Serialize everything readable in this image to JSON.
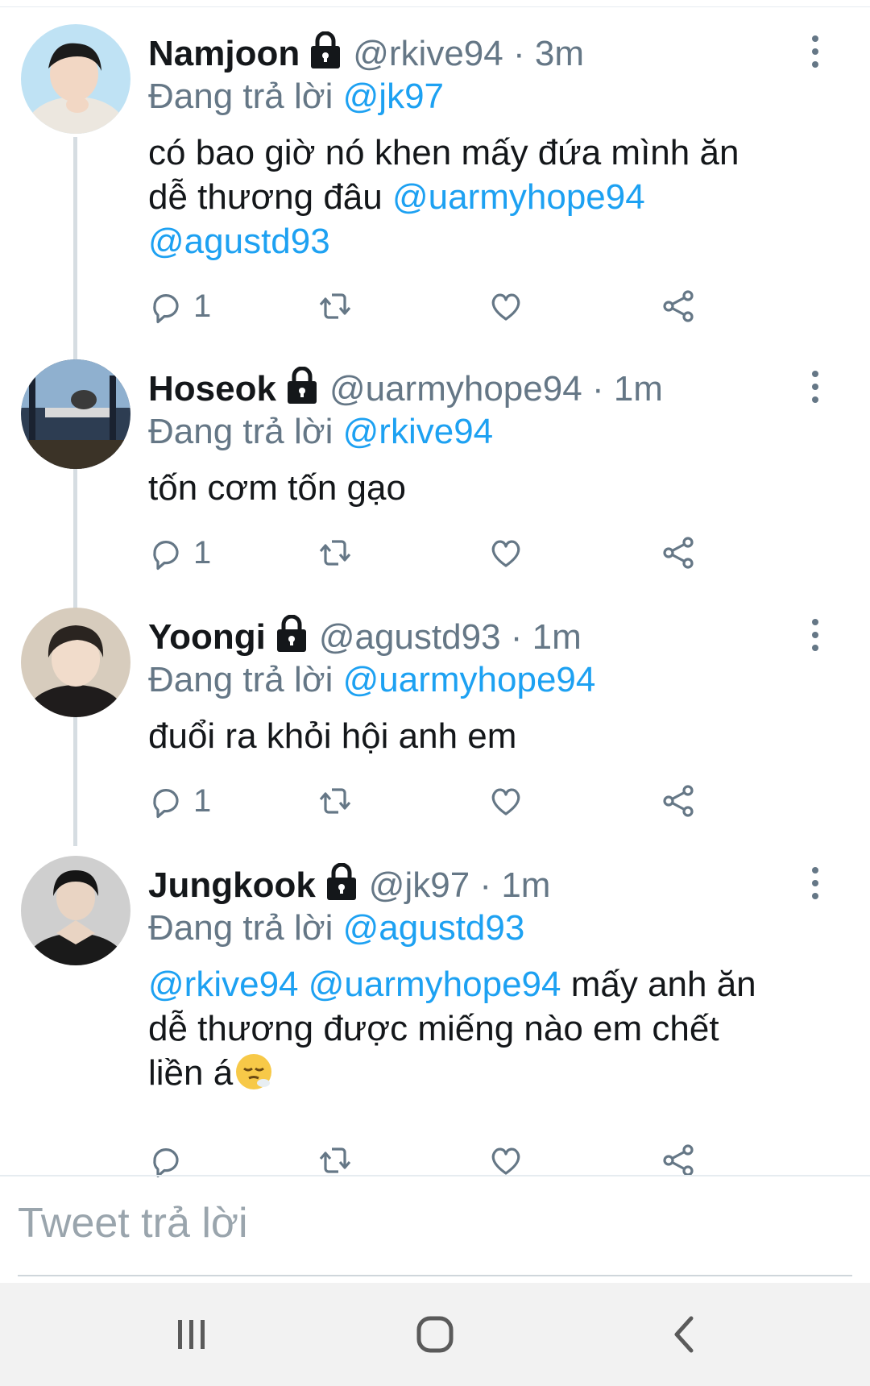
{
  "colors": {
    "accent": "#1da1f2",
    "secondary_text": "#657786",
    "primary_text": "#14171a"
  },
  "replying_prefix": "Đang trả lời",
  "tweets": [
    {
      "name": "Namjoon",
      "handle": "@rkive94",
      "dot": "·",
      "time": "3m",
      "replying_to": "@jk97",
      "body_line1": "có bao giờ nó khen mấy đứa mình ăn",
      "body_line2_text": "dễ thương đâu ",
      "body_line2_mention": "@uarmyhope94",
      "body_line3_mention": "@agustd93",
      "reply_count": "1"
    },
    {
      "name": "Hoseok",
      "handle": "@uarmyhope94",
      "dot": "·",
      "time": "1m",
      "replying_to": "@rkive94",
      "body_line1": "tốn cơm tốn gạo",
      "reply_count": "1"
    },
    {
      "name": "Yoongi",
      "handle": "@agustd93",
      "dot": "·",
      "time": "1m",
      "replying_to": "@uarmyhope94",
      "body_line1": "đuổi ra khỏi hội anh em",
      "reply_count": "1"
    },
    {
      "name": "Jungkook",
      "handle": "@jk97",
      "dot": "·",
      "time": "1m",
      "replying_to": "@agustd93",
      "body_mention1": "@rkive94",
      "body_mention2": "@uarmyhope94",
      "body_text1": " mấy anh ăn",
      "body_line2": "dễ thương được miếng nào em chết",
      "body_line3": "liền á",
      "emoji": "😮‍💨",
      "reply_count": ""
    }
  ],
  "icons": [
    "lock-icon",
    "reply-icon",
    "retweet-icon",
    "like-icon",
    "share-icon",
    "more-icon",
    "exhale-face-icon"
  ],
  "reply_composer": {
    "placeholder": "Tweet trả lời"
  },
  "navbar": {
    "buttons": [
      "recent-apps",
      "home",
      "back"
    ]
  }
}
